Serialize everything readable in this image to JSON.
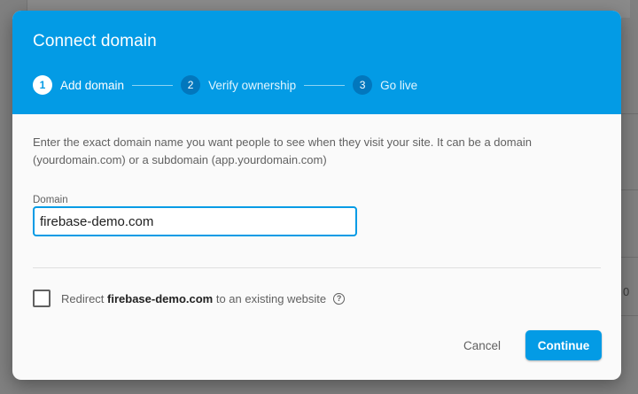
{
  "dialog": {
    "title": "Connect domain",
    "steps": [
      {
        "number": "1",
        "label": "Add domain",
        "state": "active"
      },
      {
        "number": "2",
        "label": "Verify ownership",
        "state": "inactive"
      },
      {
        "number": "3",
        "label": "Go live",
        "state": "inactive"
      }
    ],
    "description": "Enter the exact domain name you want people to see when they visit your site. It can be a domain (yourdomain.com) or a subdomain (app.yourdomain.com)",
    "domain_field": {
      "label": "Domain",
      "value": "firebase-demo.com"
    },
    "redirect": {
      "prefix": "Redirect ",
      "domain": "firebase-demo.com",
      "suffix": " to an existing website",
      "checked": false,
      "help_icon": "help-circle-icon"
    },
    "actions": {
      "cancel_label": "Cancel",
      "continue_label": "Continue"
    }
  },
  "background": {
    "partial_text": "0"
  },
  "colors": {
    "header": "#039be5",
    "step_inactive": "#0277bd",
    "primary_button": "#039be5"
  }
}
